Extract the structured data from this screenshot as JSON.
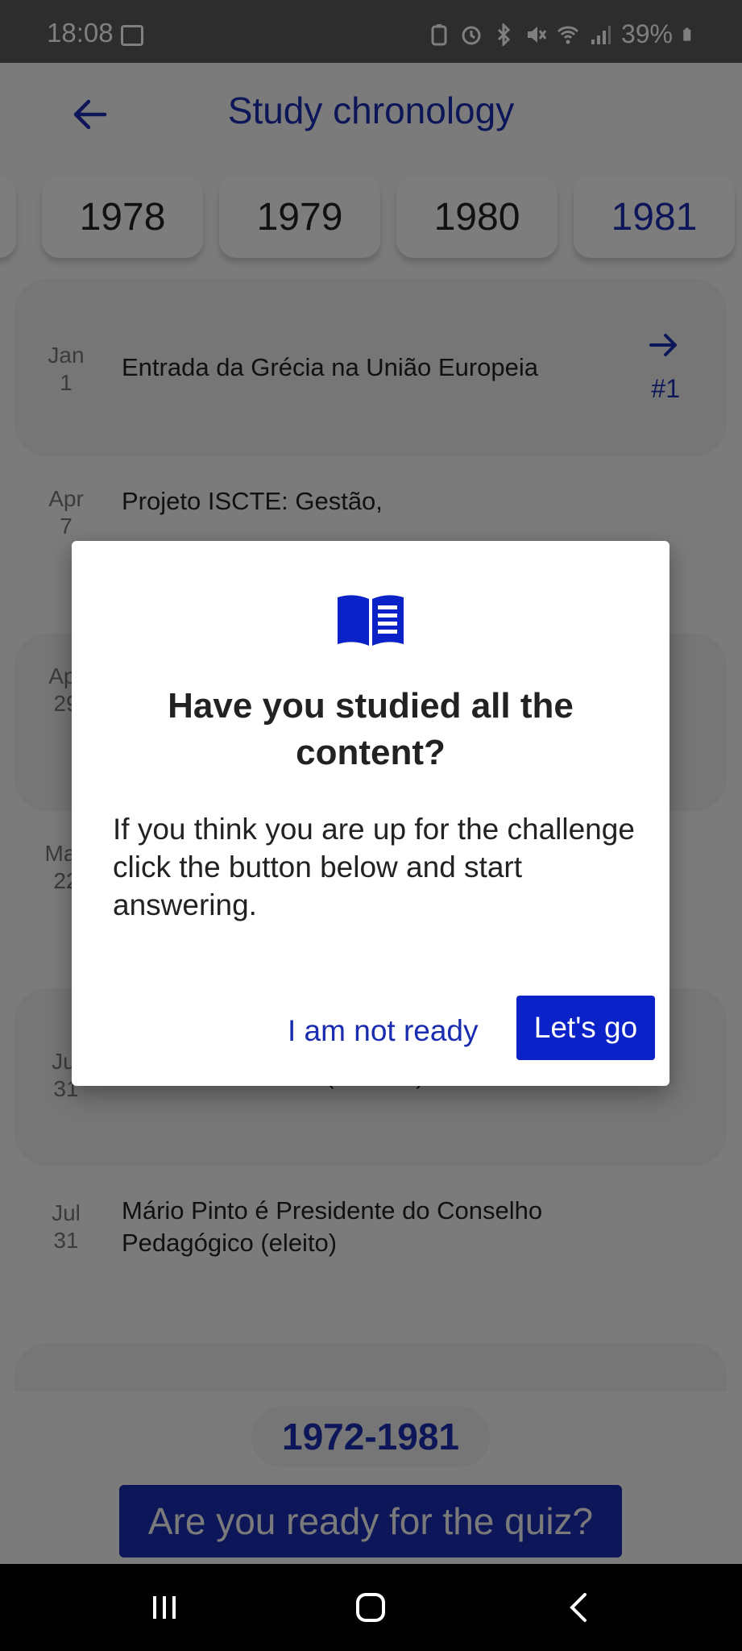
{
  "status_bar": {
    "time": "18:08",
    "battery": "39%",
    "icons": [
      "gallery-icon",
      "battery-saver-icon",
      "alarm-icon",
      "bluetooth-icon",
      "mute-icon",
      "wifi-icon",
      "signal-icon",
      "battery-icon"
    ]
  },
  "header": {
    "title": "Study chronology",
    "back_icon": "arrow-left-icon"
  },
  "years": [
    "1978",
    "1979",
    "1980",
    "1981"
  ],
  "active_year": "1981",
  "events": [
    {
      "month": "Jan",
      "day": "1",
      "title": "Entrada da Grécia na União Europeia",
      "number": "#1"
    },
    {
      "month": "Apr",
      "day": "7",
      "title": "Projeto ISCTE: Gestão,"
    },
    {
      "month": "Apr",
      "day": "29",
      "title": ""
    },
    {
      "month": "May",
      "day": "22",
      "title": ""
    },
    {
      "month": "Jul",
      "day": "31",
      "title": "Conselho Diretivo (reeleito)"
    },
    {
      "month": "Jul",
      "day": "31",
      "title": "Mário Pinto é Presidente do Conselho Pedagógico (eleito)"
    }
  ],
  "footer": {
    "range": "1972-1981",
    "quiz_button": "Are you ready for the quiz?"
  },
  "dialog": {
    "icon": "book-icon",
    "title": "Have you studied all the content?",
    "body": "If you think you are up for the challenge click the button below and start answering.",
    "cancel_label": "I am not ready",
    "confirm_label": "Let's go"
  },
  "colors": {
    "accent": "#1a2cb0",
    "button": "#0a22c7",
    "scrim": "rgba(0,0,0,0.5)"
  }
}
